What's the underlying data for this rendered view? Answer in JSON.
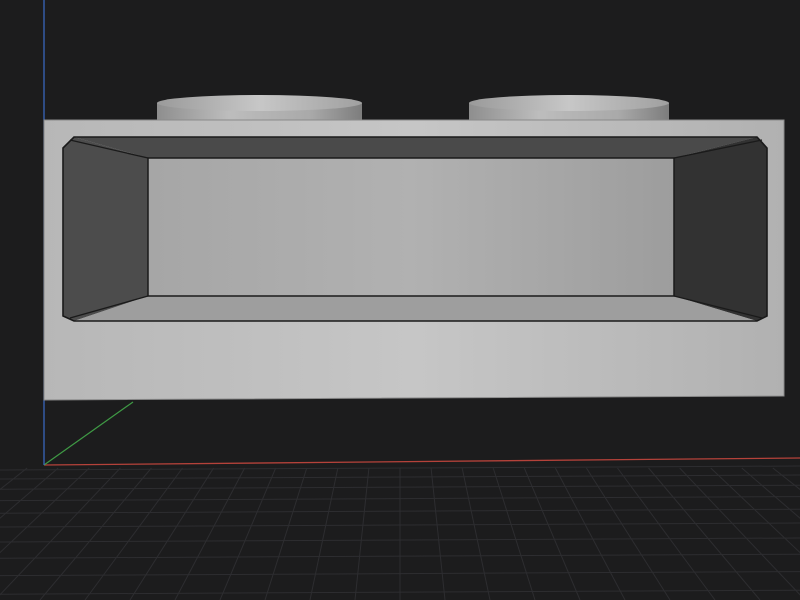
{
  "viewport": {
    "background_color": "#1c1c1d",
    "grid_visible": true,
    "grid_color": "#2d2d30",
    "axes": {
      "x_color": "#b5423a",
      "y_color": "#3f9a45",
      "z_color": "#3b6bc9"
    },
    "model": {
      "type": "2x1 brick, underside view",
      "stud_count": 2,
      "color": "#b4b4b4"
    }
  }
}
